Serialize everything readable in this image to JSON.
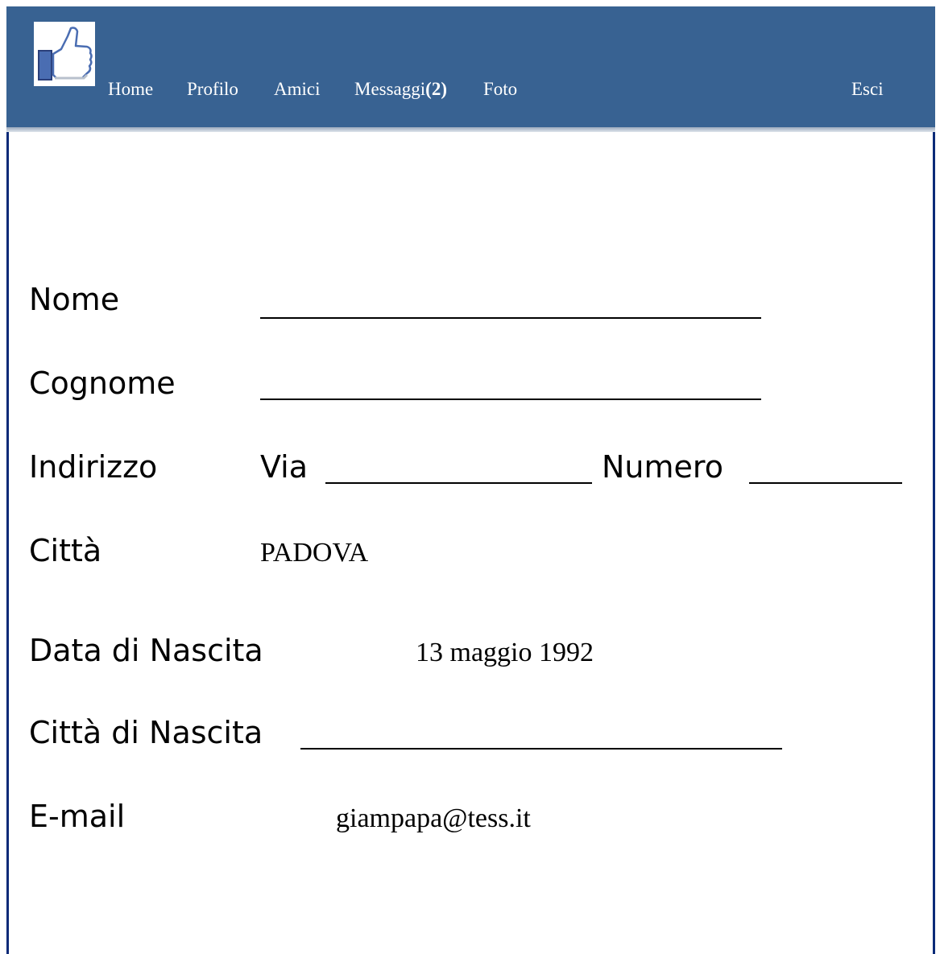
{
  "nav": {
    "home": "Home",
    "profile": "Profilo",
    "friends": "Amici",
    "messages": "Messaggi",
    "messages_count": "(2)",
    "photos": "Foto",
    "logout": "Esci"
  },
  "brand": {
    "header_color": "#386292",
    "logo_icon": "thumbs-up-icon"
  },
  "form": {
    "nome_label": "Nome",
    "nome_value": "",
    "cognome_label": "Cognome",
    "cognome_value": "",
    "indirizzo_label": "Indirizzo",
    "via_label": "Via",
    "via_value": "",
    "numero_label": "Numero",
    "numero_value": "",
    "citta_label": "Città",
    "citta_value": "PADOVA",
    "data_nascita_label": "Data di Nascita",
    "data_nascita_value": "13 maggio 1992",
    "citta_nascita_label": "Città di Nascita",
    "citta_nascita_value": "",
    "email_label": "E-mail",
    "email_value": "giampapa@tess.it"
  }
}
